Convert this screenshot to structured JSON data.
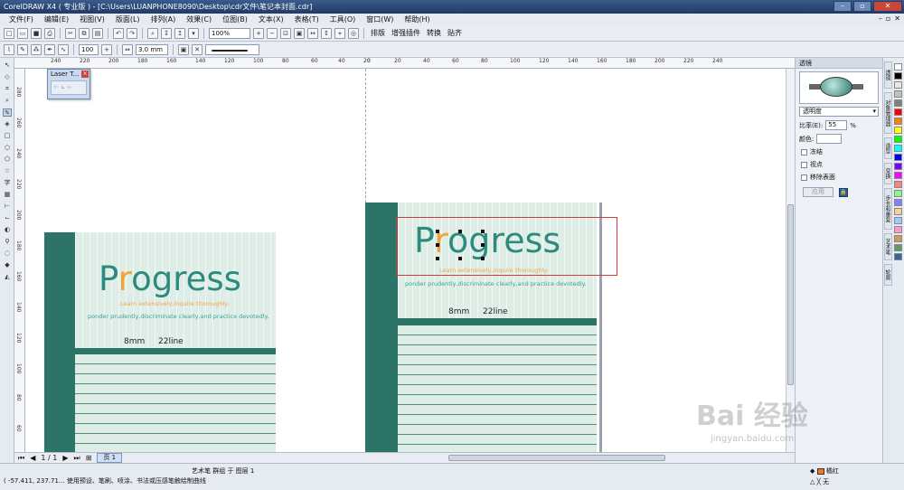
{
  "window": {
    "title": "CorelDRAW X4 ( 专业版 ) - [C:\\Users\\LUANPHONE8090\\Desktop\\cdr文件\\笔记本封面.cdr]"
  },
  "menu": [
    "文件(F)",
    "编辑(E)",
    "视图(V)",
    "版面(L)",
    "排列(A)",
    "效果(C)",
    "位图(B)",
    "文本(X)",
    "表格(T)",
    "工具(O)",
    "窗口(W)",
    "帮助(H)"
  ],
  "toolbar": {
    "zoom": "100%",
    "buttons": [
      "排版",
      "增强插件",
      "转换",
      "贴齐"
    ]
  },
  "propbar": {
    "size_value": "100",
    "width_value": "3.0 mm"
  },
  "floating_window": {
    "title": "Laser T..."
  },
  "ruler": {
    "h_ticks": [
      "240",
      "220",
      "200",
      "180",
      "160",
      "140",
      "120",
      "100",
      "80",
      "60",
      "40",
      "20",
      "0",
      "20",
      "40",
      "60",
      "80",
      "100",
      "120",
      "140",
      "160",
      "180",
      "200",
      "220",
      "240"
    ],
    "v_ticks": [
      "280",
      "260",
      "240",
      "220",
      "200",
      "180",
      "160",
      "140",
      "120",
      "100",
      "80",
      "60"
    ]
  },
  "artwork_left": {
    "logo_p": "P",
    "logo_r": "r",
    "logo_rest": "ogress",
    "tagline": "Learn extensively,inquire thoroughly.",
    "motto": "ponder prudently,discriminate clearly,and practice devotedly.",
    "spec_size": "8mm",
    "spec_lines": "22line"
  },
  "artwork_right": {
    "logo_p": "P",
    "logo_r": "r",
    "logo_rest": "ogress",
    "tagline": "Learn extensively,inquire thoroughly.",
    "motto": "ponder prudently,discriminate clearly,and practice devotedly.",
    "spec_size": "8mm",
    "spec_lines": "22line"
  },
  "page_nav": {
    "count": "1 / 1",
    "tab": "页 1"
  },
  "status": {
    "object": "艺术笔 群组 于 图层 1",
    "coords": "( -57.411, 237.71... 使用预设、笔刷、喷涂、书法或压感笔触绘制曲线",
    "fill_label": "橘红",
    "outline_label": "无"
  },
  "dock": {
    "title": "透镜",
    "lens_type": "透明度",
    "rate_label": "比率(E):",
    "rate_value": "55",
    "rate_unit": "%",
    "color_label": "颜色:",
    "freeze_label": "冻结",
    "viewpoint_label": "视点",
    "remove_face_label": "移除表面",
    "apply_label": "应用"
  },
  "palette_colors": [
    "#ffffff",
    "#000000",
    "#e8e8e8",
    "#c0c0c0",
    "#808080",
    "#ff0000",
    "#ff8000",
    "#ffff00",
    "#00ff00",
    "#00ffff",
    "#0000ff",
    "#8000ff",
    "#ff00ff",
    "#ff8080",
    "#80ff80",
    "#8080ff",
    "#ffcc99",
    "#99ccff",
    "#ff99cc",
    "#cc9966",
    "#669966",
    "#336699"
  ],
  "side_tabs": [
    "透镜",
    "对象管理器",
    "造型",
    "变换",
    "步长和重复",
    "艺术笔",
    "轮廓"
  ],
  "watermark": {
    "text": "Bai 经验",
    "url": "jingyan.baidu.com"
  },
  "colors": {
    "teal": "#2c7468",
    "orange": "#f0a33a",
    "selection": "#d93a3a"
  }
}
